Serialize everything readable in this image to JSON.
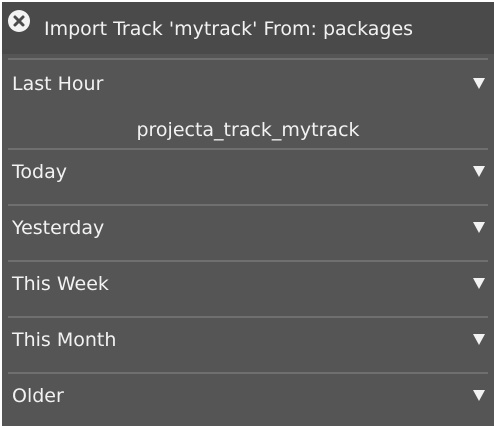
{
  "window": {
    "title": "Import Track 'mytrack' From: packages"
  },
  "sections": [
    {
      "label": "Last Hour",
      "items": [
        "projecta_track_mytrack"
      ]
    },
    {
      "label": "Today"
    },
    {
      "label": "Yesterday"
    },
    {
      "label": "This Week"
    },
    {
      "label": "This Month"
    },
    {
      "label": "Older"
    }
  ],
  "colors": {
    "panel_bg": "#555555",
    "titlebar_bg": "#4a4a4a",
    "text": "#f2f2f2",
    "separator": "#6f6f6f"
  },
  "icons": {
    "close": "close-circle-icon",
    "expand": "triangle-down-icon"
  }
}
